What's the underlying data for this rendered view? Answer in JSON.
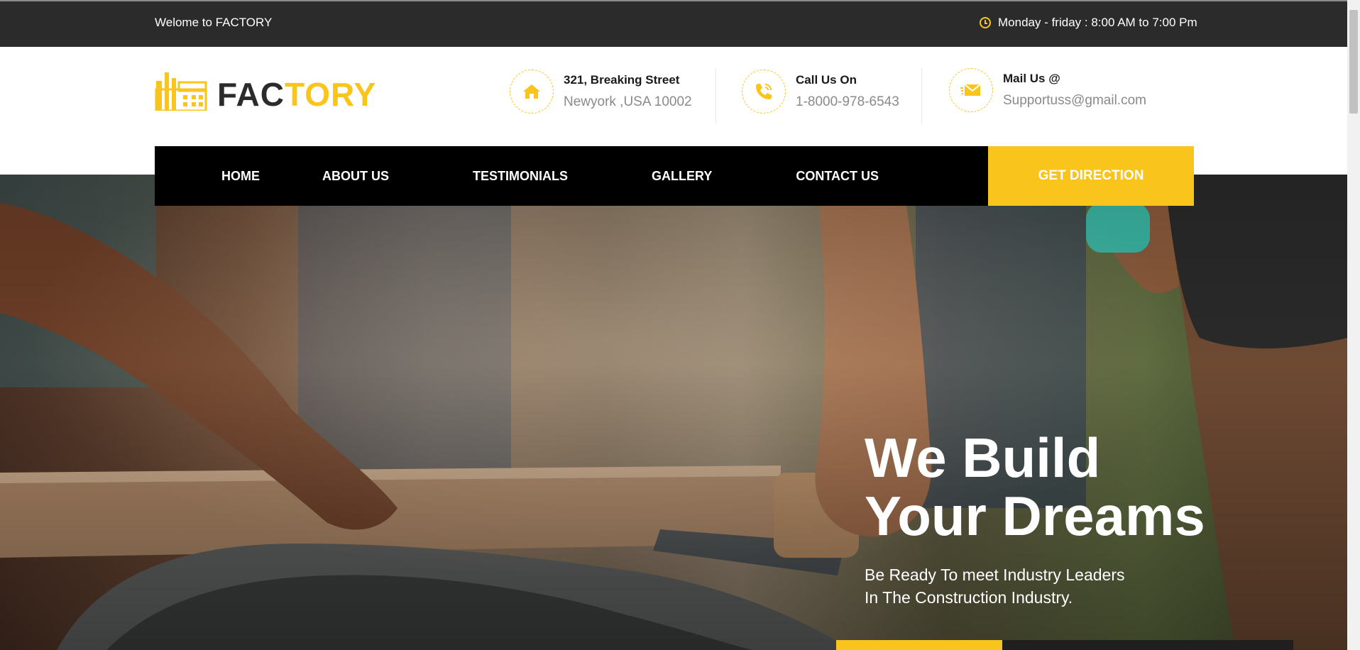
{
  "topbar": {
    "welcome": "Welome to FACTORY",
    "hours": "Monday - friday : 8:00 AM to 7:00 Pm"
  },
  "logo": {
    "part1": "FAC",
    "part2": "TORY"
  },
  "contact": {
    "address_title": "321, Breaking Street",
    "address_value": "Newyork ,USA 10002",
    "phone_title": "Call Us On",
    "phone_value": "1-8000-978-6543",
    "mail_title": "Mail Us @",
    "mail_value": "Supportuss@gmail.com"
  },
  "nav": {
    "items": [
      {
        "label": "HOME"
      },
      {
        "label": "ABOUT US"
      },
      {
        "label": "TESTIMONIALS"
      },
      {
        "label": "GALLERY"
      },
      {
        "label": "CONTACT US"
      }
    ],
    "cta": "GET DIRECTION"
  },
  "hero": {
    "title_line1": "We Build",
    "title_line2": "Your Dreams",
    "subtitle_line1": "Be Ready To meet Industry Leaders",
    "subtitle_line2": "In The Construction Industry."
  },
  "colors": {
    "accent": "#f9c51c",
    "dark": "#2b2b2b",
    "nav_bg": "#000000"
  },
  "icons": {
    "hours": "clock-icon",
    "address": "home-icon",
    "phone": "phone-icon",
    "mail": "envelope-icon",
    "logo": "factory-icon"
  }
}
